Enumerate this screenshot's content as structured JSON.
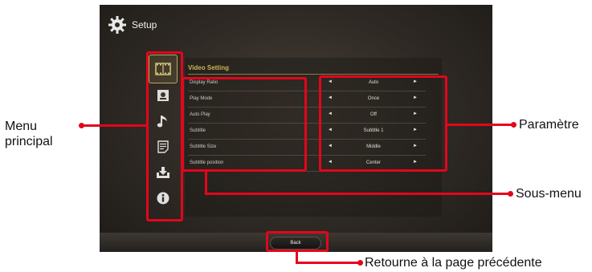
{
  "app": {
    "title": "Setup",
    "icon": "gear-icon"
  },
  "sidebar": {
    "items": [
      {
        "icon": "video-icon",
        "active": true
      },
      {
        "icon": "photo-icon",
        "active": false
      },
      {
        "icon": "music-icon",
        "active": false
      },
      {
        "icon": "document-icon",
        "active": false
      },
      {
        "icon": "update-icon",
        "active": false
      },
      {
        "icon": "info-icon",
        "active": false
      }
    ]
  },
  "panel": {
    "title": "Video Setting",
    "rows": [
      {
        "label": "Display Ratio",
        "value": "Auto"
      },
      {
        "label": "Play Mode",
        "value": "Once"
      },
      {
        "label": "Auto Play",
        "value": "Off"
      },
      {
        "label": "Subtitle",
        "value": "Subtitle 1"
      },
      {
        "label": "Subtitle Size",
        "value": "Middle"
      },
      {
        "label": "Subtitle position",
        "value": "Center"
      }
    ],
    "arrow_left": "◄",
    "arrow_right": "►"
  },
  "bottom": {
    "back_label": "Back"
  },
  "annotations": {
    "menu_principal_1": "Menu",
    "menu_principal_2": "principal",
    "parametre": "Paramètre",
    "sous_menu": "Sous-menu",
    "retourne": "Retourne à la page précédente"
  },
  "colors": {
    "highlight": "#e3061b",
    "accent": "#c9b45a"
  }
}
